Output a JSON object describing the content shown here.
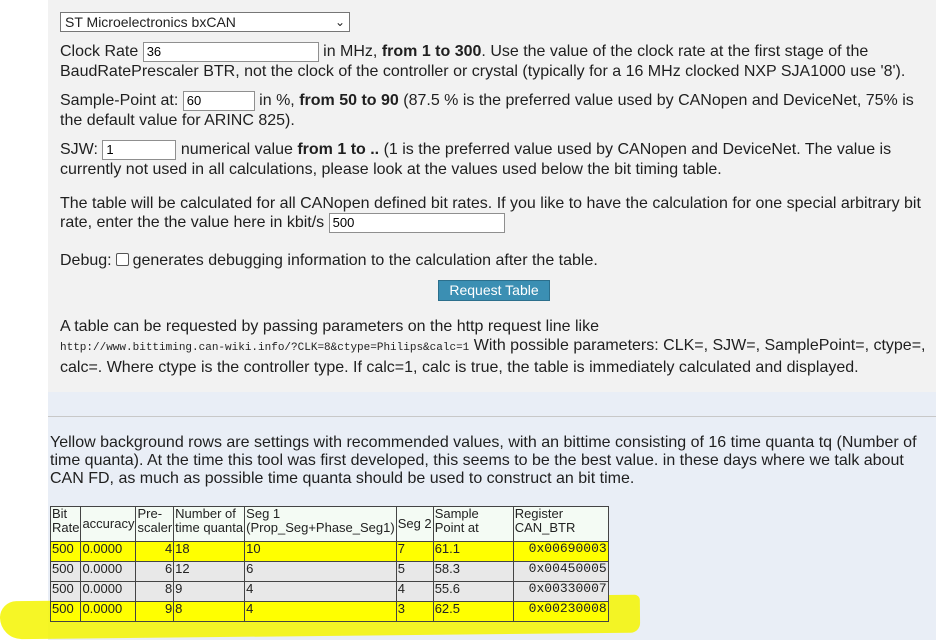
{
  "form": {
    "controller_select": "ST Microelectronics bxCAN",
    "clock": {
      "label": "Clock Rate",
      "value": "36",
      "text_a": " in MHz, ",
      "range": "from 1 to 300",
      "text_b": ". Use the value of the clock rate at the first stage of the BaudRatePrescaler BTR, not the clock of the controller or crystal (typically for a 16 MHz clocked NXP SJA1000 use '8')."
    },
    "sample_point": {
      "label": "Sample-Point at:",
      "value": "60",
      "text_a": " in %, ",
      "range": "from 50 to 90",
      "text_b": " (87.5 % is the preferred value used by CANopen and DeviceNet, 75% is the default value for ARINC 825)."
    },
    "sjw": {
      "label": "SJW:",
      "value": "1",
      "text_a": " numerical value ",
      "range": "from 1 to ..",
      "text_b": " (1 is the preferred value used by CANopen and DeviceNet. The value is currently not used in all calculations, please look at the values used below the bit timing table."
    },
    "bitrate": {
      "text": "The table will be calculated for all CANopen defined bit rates. If you like to have the calculation for one special arbitrary bit rate, enter the the value here in kbit/s ",
      "value": "500"
    },
    "debug": {
      "label": "Debug:",
      "text": "generates debugging information to the calculation after the table."
    },
    "request_button": "Request Table",
    "info": {
      "text_a": "A table can be requested by passing parameters on the http request line like",
      "url": "http://www.bittiming.can-wiki.info/?CLK=8&ctype=Philips&calc=1",
      "text_b": " With possible parameters: CLK=, SJW=, SamplePoint=, ctype=, calc=. Where ctype is the controller type. If calc=1, calc is true, the table is immediately calculated and displayed."
    }
  },
  "results": {
    "intro": "Yellow background rows are settings with recommended values, with an bittime consisting of 16 time quanta tq (Number of time quanta). At the time this tool was first developed, this seems to be the best value. in these days where we talk about CAN FD, as much as possible time quanta should be used to construct an bit time.",
    "table": {
      "headers": [
        "Bit Rate",
        "accuracy",
        "Pre-scaler",
        "Number of time quanta",
        "Seg 1 (Prop_Seg+Phase_Seg1)",
        "Seg 2",
        "Sample Point at",
        "Register CAN_BTR"
      ],
      "rows": [
        {
          "bitrate": "500",
          "accuracy": "0.0000",
          "prescaler": "4",
          "tq": "18",
          "seg1": "10",
          "seg2": "7",
          "sp": "61.1",
          "btr": "0x00690003"
        },
        {
          "bitrate": "500",
          "accuracy": "0.0000",
          "prescaler": "6",
          "tq": "12",
          "seg1": "6",
          "seg2": "5",
          "sp": "58.3",
          "btr": "0x00450005"
        },
        {
          "bitrate": "500",
          "accuracy": "0.0000",
          "prescaler": "8",
          "tq": "9",
          "seg1": "4",
          "seg2": "4",
          "sp": "55.6",
          "btr": "0x00330007"
        },
        {
          "bitrate": "500",
          "accuracy": "0.0000",
          "prescaler": "9",
          "tq": "8",
          "seg1": "4",
          "seg2": "3",
          "sp": "62.5",
          "btr": "0x00230008"
        }
      ]
    }
  },
  "colors": {
    "recommended_row": "#ffff00",
    "button": "#3b8fb3",
    "highlight_marker": "#f4f400"
  }
}
